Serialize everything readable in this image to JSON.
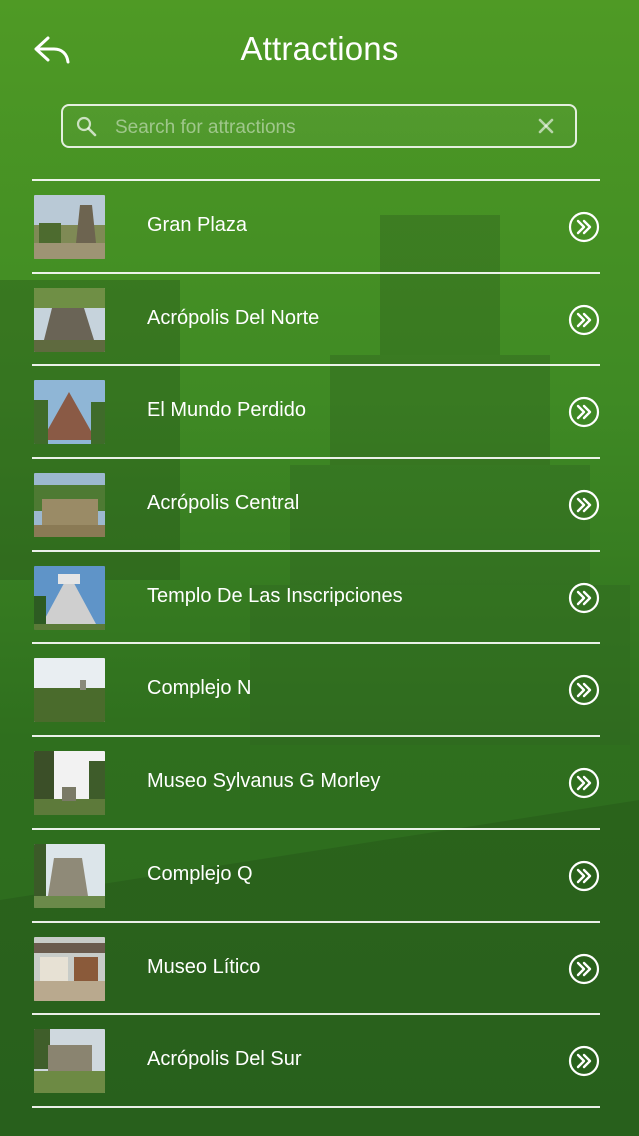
{
  "header": {
    "title": "Attractions"
  },
  "search": {
    "placeholder": "Search for attractions"
  },
  "attractions": [
    {
      "label": "Gran Plaza"
    },
    {
      "label": "Acrópolis Del Norte"
    },
    {
      "label": "El Mundo Perdido"
    },
    {
      "label": "Acrópolis Central"
    },
    {
      "label": "Templo De Las Inscripciones"
    },
    {
      "label": "Complejo N"
    },
    {
      "label": "Museo Sylvanus G Morley"
    },
    {
      "label": "Complejo Q"
    },
    {
      "label": "Museo Lítico"
    },
    {
      "label": "Acrópolis Del Sur"
    }
  ],
  "theme": {
    "background": "#3f8a24",
    "foreground": "#ffffff"
  }
}
